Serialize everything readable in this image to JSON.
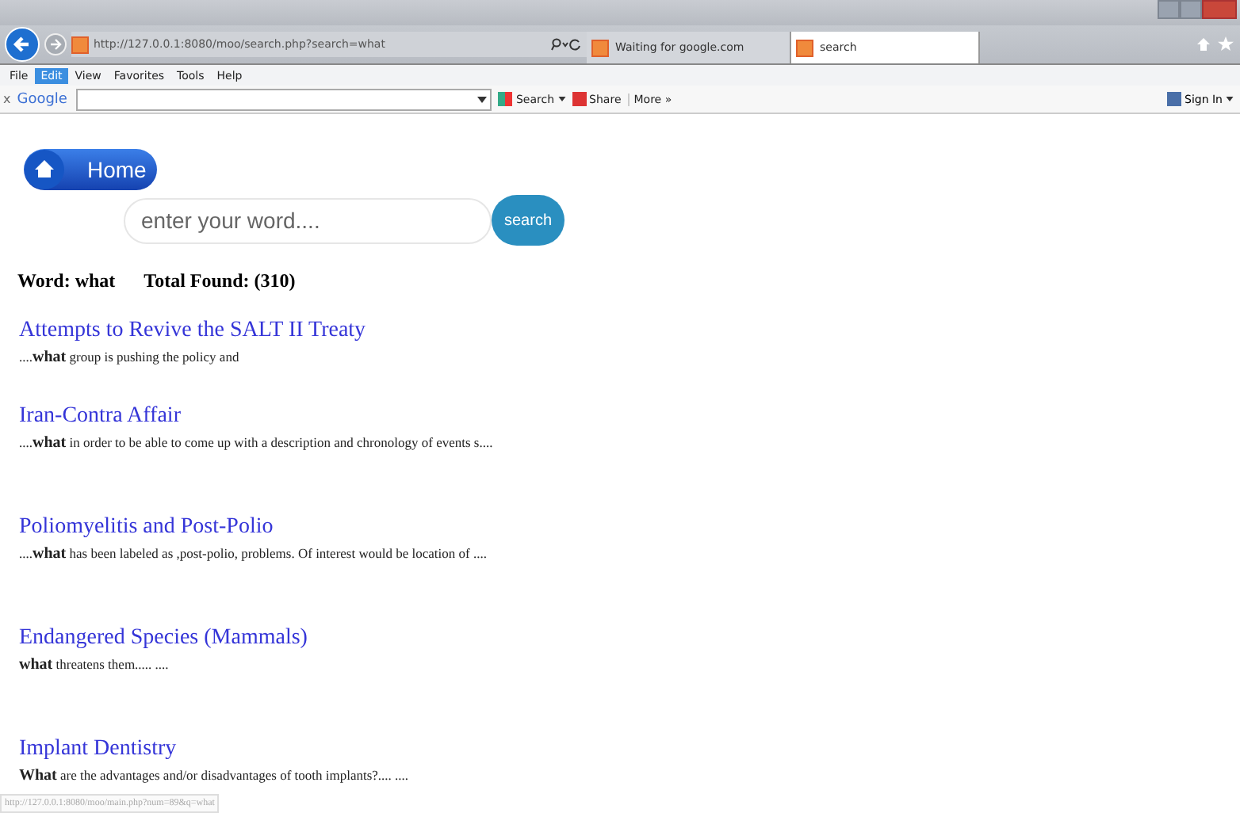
{
  "browser": {
    "address": "http://127.0.0.1:8080/moo/search.php?search=what",
    "tabs": [
      {
        "label": "Waiting for google.com",
        "selected": false
      },
      {
        "label": "search",
        "selected": true
      }
    ],
    "menu": [
      {
        "label": "File",
        "selected": false
      },
      {
        "label": "Edit",
        "selected": true
      },
      {
        "label": "View",
        "selected": false
      },
      {
        "label": "Favorites",
        "selected": false
      },
      {
        "label": "Tools",
        "selected": false
      },
      {
        "label": "Help",
        "selected": false
      }
    ],
    "toolbar": {
      "close": "x",
      "brand": "Google",
      "search": "Search",
      "share": "Share",
      "more": "More »",
      "sign_in": "Sign In"
    },
    "status_url": "http://127.0.0.1:8080/moo/main.php?num=89&q=what"
  },
  "page": {
    "home": "Home",
    "search_placeholder": "enter your word....",
    "search_button": "search",
    "word": "Word: what",
    "total": "Total Found: (310)",
    "results": [
      {
        "title": "Attempts to Revive the SALT II Treaty",
        "snippet": "....**what** group is pushing the policy and"
      },
      {
        "title": "Iran-Contra Affair",
        "snippet": "....**what** in order to be able to come up with a description and chronology of events s...."
      },
      {
        "title": "Poliomyelitis and Post-Polio",
        "snippet": "....**what** has been labeled as ,post-polio, problems. Of interest would be location of ...."
      },
      {
        "title": "Endangered Species (Mammals)",
        "snippet": "**what** threatens them..... ...."
      },
      {
        "title": "Implant Dentistry",
        "snippet": "**What** are the advantages and/or disadvantages of tooth implants?.... ...."
      }
    ]
  }
}
